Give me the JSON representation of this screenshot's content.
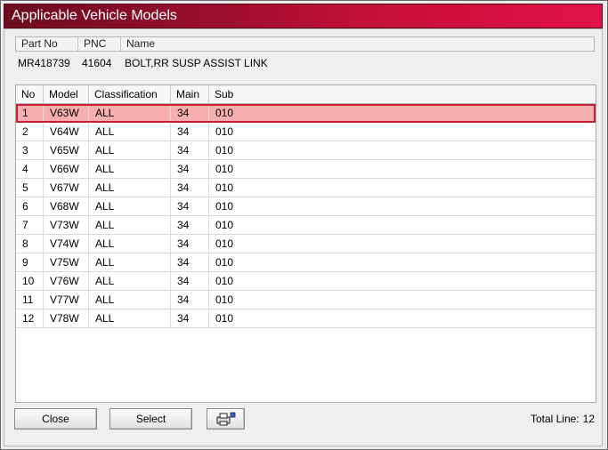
{
  "window": {
    "title": "Applicable Vehicle Models"
  },
  "part_info": {
    "headers": {
      "part_no": "Part No",
      "pnc": "PNC",
      "name": "Name"
    },
    "values": {
      "part_no": "MR418739",
      "pnc": "41604",
      "name": "BOLT,RR SUSP ASSIST LINK"
    }
  },
  "table": {
    "columns": {
      "no": "No",
      "model": "Model",
      "classification": "Classification",
      "main": "Main",
      "sub": "Sub"
    },
    "rows": [
      {
        "no": "1",
        "model": "V63W",
        "classification": "ALL",
        "main": "34",
        "sub": "010"
      },
      {
        "no": "2",
        "model": "V64W",
        "classification": "ALL",
        "main": "34",
        "sub": "010"
      },
      {
        "no": "3",
        "model": "V65W",
        "classification": "ALL",
        "main": "34",
        "sub": "010"
      },
      {
        "no": "4",
        "model": "V66W",
        "classification": "ALL",
        "main": "34",
        "sub": "010"
      },
      {
        "no": "5",
        "model": "V67W",
        "classification": "ALL",
        "main": "34",
        "sub": "010"
      },
      {
        "no": "6",
        "model": "V68W",
        "classification": "ALL",
        "main": "34",
        "sub": "010"
      },
      {
        "no": "7",
        "model": "V73W",
        "classification": "ALL",
        "main": "34",
        "sub": "010"
      },
      {
        "no": "8",
        "model": "V74W",
        "classification": "ALL",
        "main": "34",
        "sub": "010"
      },
      {
        "no": "9",
        "model": "V75W",
        "classification": "ALL",
        "main": "34",
        "sub": "010"
      },
      {
        "no": "10",
        "model": "V76W",
        "classification": "ALL",
        "main": "34",
        "sub": "010"
      },
      {
        "no": "11",
        "model": "V77W",
        "classification": "ALL",
        "main": "34",
        "sub": "010"
      },
      {
        "no": "12",
        "model": "V78W",
        "classification": "ALL",
        "main": "34",
        "sub": "010"
      }
    ],
    "selected_row": "1"
  },
  "footer": {
    "close_label": "Close",
    "select_label": "Select",
    "print_icon": "printer-icon",
    "total_label": "Total Line:",
    "total_value": "12"
  },
  "colors": {
    "title_start": "#6b0d1f",
    "title_end": "#e0124a",
    "selection_fill": "#f7aeae",
    "selection_border": "#c42030"
  }
}
